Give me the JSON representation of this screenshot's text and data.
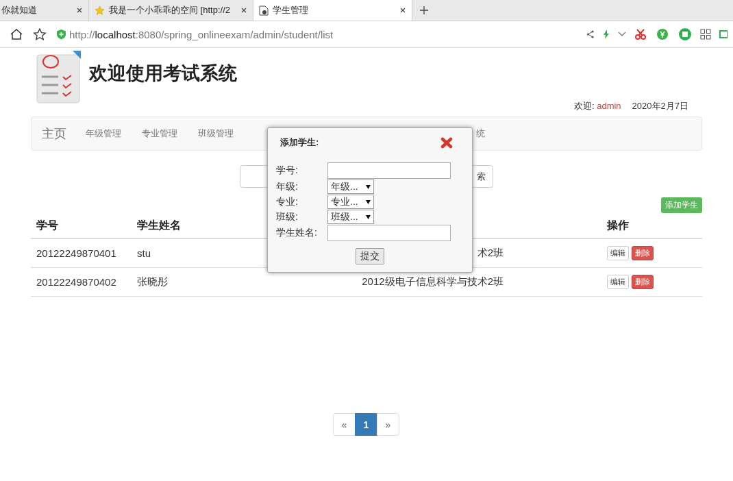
{
  "browser": {
    "tabs": [
      {
        "title": "你就知道",
        "selected": false
      },
      {
        "title": "我是一个小乖乖的空间 [http://2",
        "selected": false
      },
      {
        "title": "学生管理",
        "selected": true
      }
    ],
    "url": "http://**localhost**:8080/spring_onlineexam/admin/student/list"
  },
  "header": {
    "title": "欢迎使用考试系统",
    "welcome_label": "欢迎:",
    "user": "admin",
    "date": "2020年2月7日"
  },
  "nav": {
    "brand": "主页",
    "items": [
      "年级管理",
      "专业管理",
      "班级管理",
      "统"
    ]
  },
  "search": {
    "button": "索"
  },
  "add_button": "添加学生",
  "table": {
    "columns": [
      "学号",
      "学生姓名",
      "操作"
    ],
    "rows": [
      {
        "cells": [
          "20122249870401",
          "stu",
          "术2班"
        ],
        "actions": [
          "编辑",
          "删除"
        ]
      },
      {
        "cells": [
          "20122249870402",
          "张晓彤",
          "2012级电子信息科学与技术2班"
        ],
        "actions": [
          "编辑",
          "删除"
        ]
      }
    ]
  },
  "pagination": {
    "prev": "«",
    "pages": [
      {
        "label": "1",
        "selected": true
      }
    ],
    "next": "»"
  },
  "dialog": {
    "title": "添加学生:",
    "fields": [
      {
        "label": "学号:",
        "kind": "text"
      },
      {
        "label": "年级:",
        "kind": "select",
        "value": "年级..."
      },
      {
        "label": "专业:",
        "kind": "select",
        "value": "专业..."
      },
      {
        "label": "班级:",
        "kind": "select",
        "value": "班级..."
      },
      {
        "label": "学生姓名:",
        "kind": "text"
      }
    ],
    "submit": "提交"
  }
}
